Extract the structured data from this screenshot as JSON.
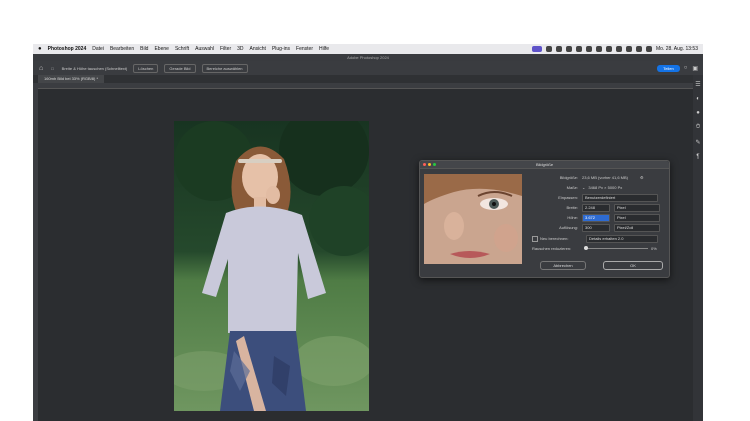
{
  "menubar": {
    "apple": "",
    "items": [
      "Photoshop 2024",
      "Datei",
      "Bearbeiten",
      "Bild",
      "Ebene",
      "Schrift",
      "Auswahl",
      "Filter",
      "3D",
      "Ansicht",
      "Plug-ins",
      "Fenster",
      "Hilfe"
    ],
    "clock": "Mo. 28. Aug. 13:53"
  },
  "app": {
    "title": "Adobe Photoshop 2024"
  },
  "options": {
    "checkbox_label": "Breite & Höhe tauschen (Schnelltext)",
    "btn1": "Löschen",
    "btn2": "Gerade Bild",
    "btn3": "Bereiche auswählen",
    "share": "Teilen"
  },
  "document": {
    "tab_label": "160mh Bild bei 33% (RGB/8) *"
  },
  "dialog": {
    "title": "Bildgröße",
    "rows": {
      "bildgroesse": {
        "label": "Bildgröße:",
        "value": "23,6 MB (vorher 41,6 MB)"
      },
      "masse": {
        "label": "Maße:",
        "value": "3468 Px × 5000 Px"
      },
      "einpassen": {
        "label": "Einpassen:",
        "value": "Benutzerdefiniert"
      },
      "breite": {
        "label": "Breite:",
        "value": "2.248",
        "unit": "Pixel"
      },
      "hoehe": {
        "label": "Höhe:",
        "value": "3.672",
        "unit": "Pixel"
      },
      "aufloesung": {
        "label": "Auflösung:",
        "value": "300",
        "unit": "Pixel/Zoll"
      }
    },
    "neu_berechnen": {
      "label": "Neu berechnen:",
      "value": "Details erhalten 2.0"
    },
    "rauschen": {
      "label": "Rauschen reduzieren:",
      "value": "0%"
    },
    "cancel_label": "Abbrechen",
    "ok_label": "OK"
  },
  "colors": {
    "accent": "#1473e6",
    "ps_icon": "#5f53c9",
    "canvas_bg": "#2b2d30"
  }
}
